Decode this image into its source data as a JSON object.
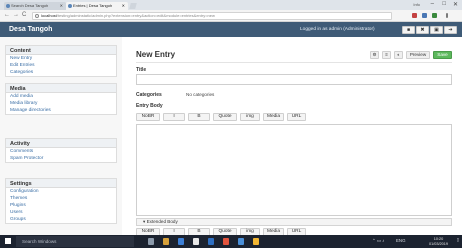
{
  "browser": {
    "tabs": [
      {
        "label": "Search Desa Tangoh"
      },
      {
        "label": "Entries | Desa Tangoh"
      }
    ],
    "user_label": "Info",
    "window_controls": [
      "–",
      "□",
      "✕"
    ],
    "nav": {
      "back": "←",
      "forward": "→",
      "reload": "C"
    },
    "url_host": "localhost",
    "url_path": "/testing/adminstatic/admin.php?extension=entry&action=edit&module=entries&entry=new"
  },
  "app": {
    "name": "Desa Tangoh",
    "logged_in_text": "Logged in as admin (Administrator)",
    "header_buttons": [
      "■",
      "✖",
      "▣",
      "➔"
    ]
  },
  "sidebar": {
    "sections": [
      {
        "title": "Content",
        "items": [
          "New Entry",
          "Edit Entries",
          "Categories"
        ]
      },
      {
        "title": "Media",
        "items": [
          "Add media",
          "Media library",
          "Manage directories"
        ]
      },
      {
        "title": "Activity",
        "items": [
          "Comments",
          "Spam Protector"
        ]
      },
      {
        "title": "Settings",
        "items": [
          "Configuration",
          "Themes",
          "Plugins",
          "Users",
          "Groups"
        ]
      }
    ]
  },
  "main": {
    "title": "New Entry",
    "toolbar": {
      "btn1": "⚙",
      "btn2": "≡",
      "btn3": "◐",
      "preview": "Preview",
      "save": "Save"
    },
    "title_label": "Title",
    "title_value": "",
    "categories_label": "Categories",
    "categories_value": "No categories",
    "entry_body_label": "Entry Body",
    "editor_buttons": [
      "NoBR",
      "I",
      "B",
      "Quote",
      "img",
      "Media",
      "URL"
    ],
    "extended_toggle": "▾ Extended Body",
    "extended_buttons": [
      "NoBR",
      "I",
      "B",
      "Quote",
      "img",
      "Media",
      "URL"
    ]
  },
  "taskbar": {
    "search_placeholder": "Search Windows",
    "tray_text": "ENG",
    "time": "10:20",
    "date": "01/03/2019"
  },
  "colors": {
    "header_bg": "#3f5b77",
    "save_green": "#5cb85c",
    "link_blue": "#3a6ea5",
    "taskbar_bg": "#1c2330"
  }
}
